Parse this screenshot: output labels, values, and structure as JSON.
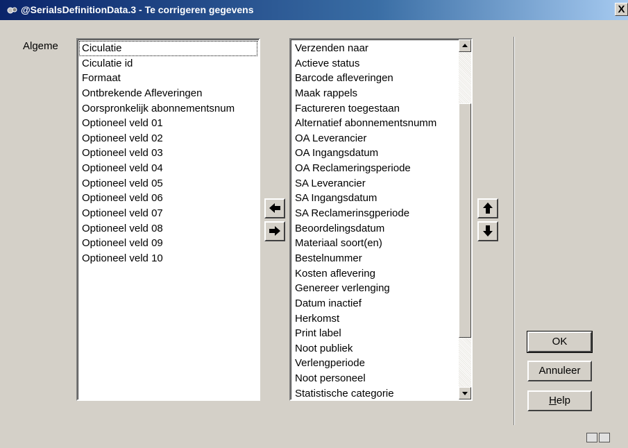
{
  "window": {
    "title": "@SerialsDefinitionData.3 - Te corrigeren gegevens",
    "close_glyph": "X"
  },
  "form": {
    "label": "Algeme"
  },
  "left_list": {
    "selected_index": 0,
    "items": [
      "Ciculatie",
      "Ciculatie id",
      "Formaat",
      "Ontbrekende Afleveringen",
      "Oorspronkelijk abonnementsnum",
      "Optioneel veld 01",
      "Optioneel veld 02",
      "Optioneel veld 03",
      "Optioneel veld 04",
      "Optioneel veld 05",
      "Optioneel veld 06",
      "Optioneel veld 07",
      "Optioneel veld 08",
      "Optioneel veld 09",
      "Optioneel veld 10"
    ]
  },
  "right_list": {
    "items": [
      "Verzenden naar",
      "Actieve status",
      "Barcode afleveringen",
      "Maak rappels",
      "Factureren toegestaan",
      "Alternatief abonnementsnumm",
      "OA Leverancier",
      "OA Ingangsdatum",
      "OA Reclameringsperiode",
      "SA Leverancier",
      "SA Ingangsdatum",
      "SA Reclamerinsgperiode",
      "Beoordelingsdatum",
      "Materiaal soort(en)",
      "Bestelnummer",
      "Kosten aflevering",
      "Genereer verlenging",
      "Datum inactief",
      "Herkomst",
      "Print label",
      "Noot publiek",
      "Verlengperiode",
      "Noot personeel",
      "Statistische categorie"
    ]
  },
  "buttons": {
    "ok": "OK",
    "cancel": "Annuleer",
    "help_accel": "H",
    "help_rest": "elp"
  },
  "icons": {
    "move_left": "arrow-left-icon",
    "move_right": "arrow-right-icon",
    "move_up": "arrow-up-icon",
    "move_down": "arrow-down-icon"
  }
}
